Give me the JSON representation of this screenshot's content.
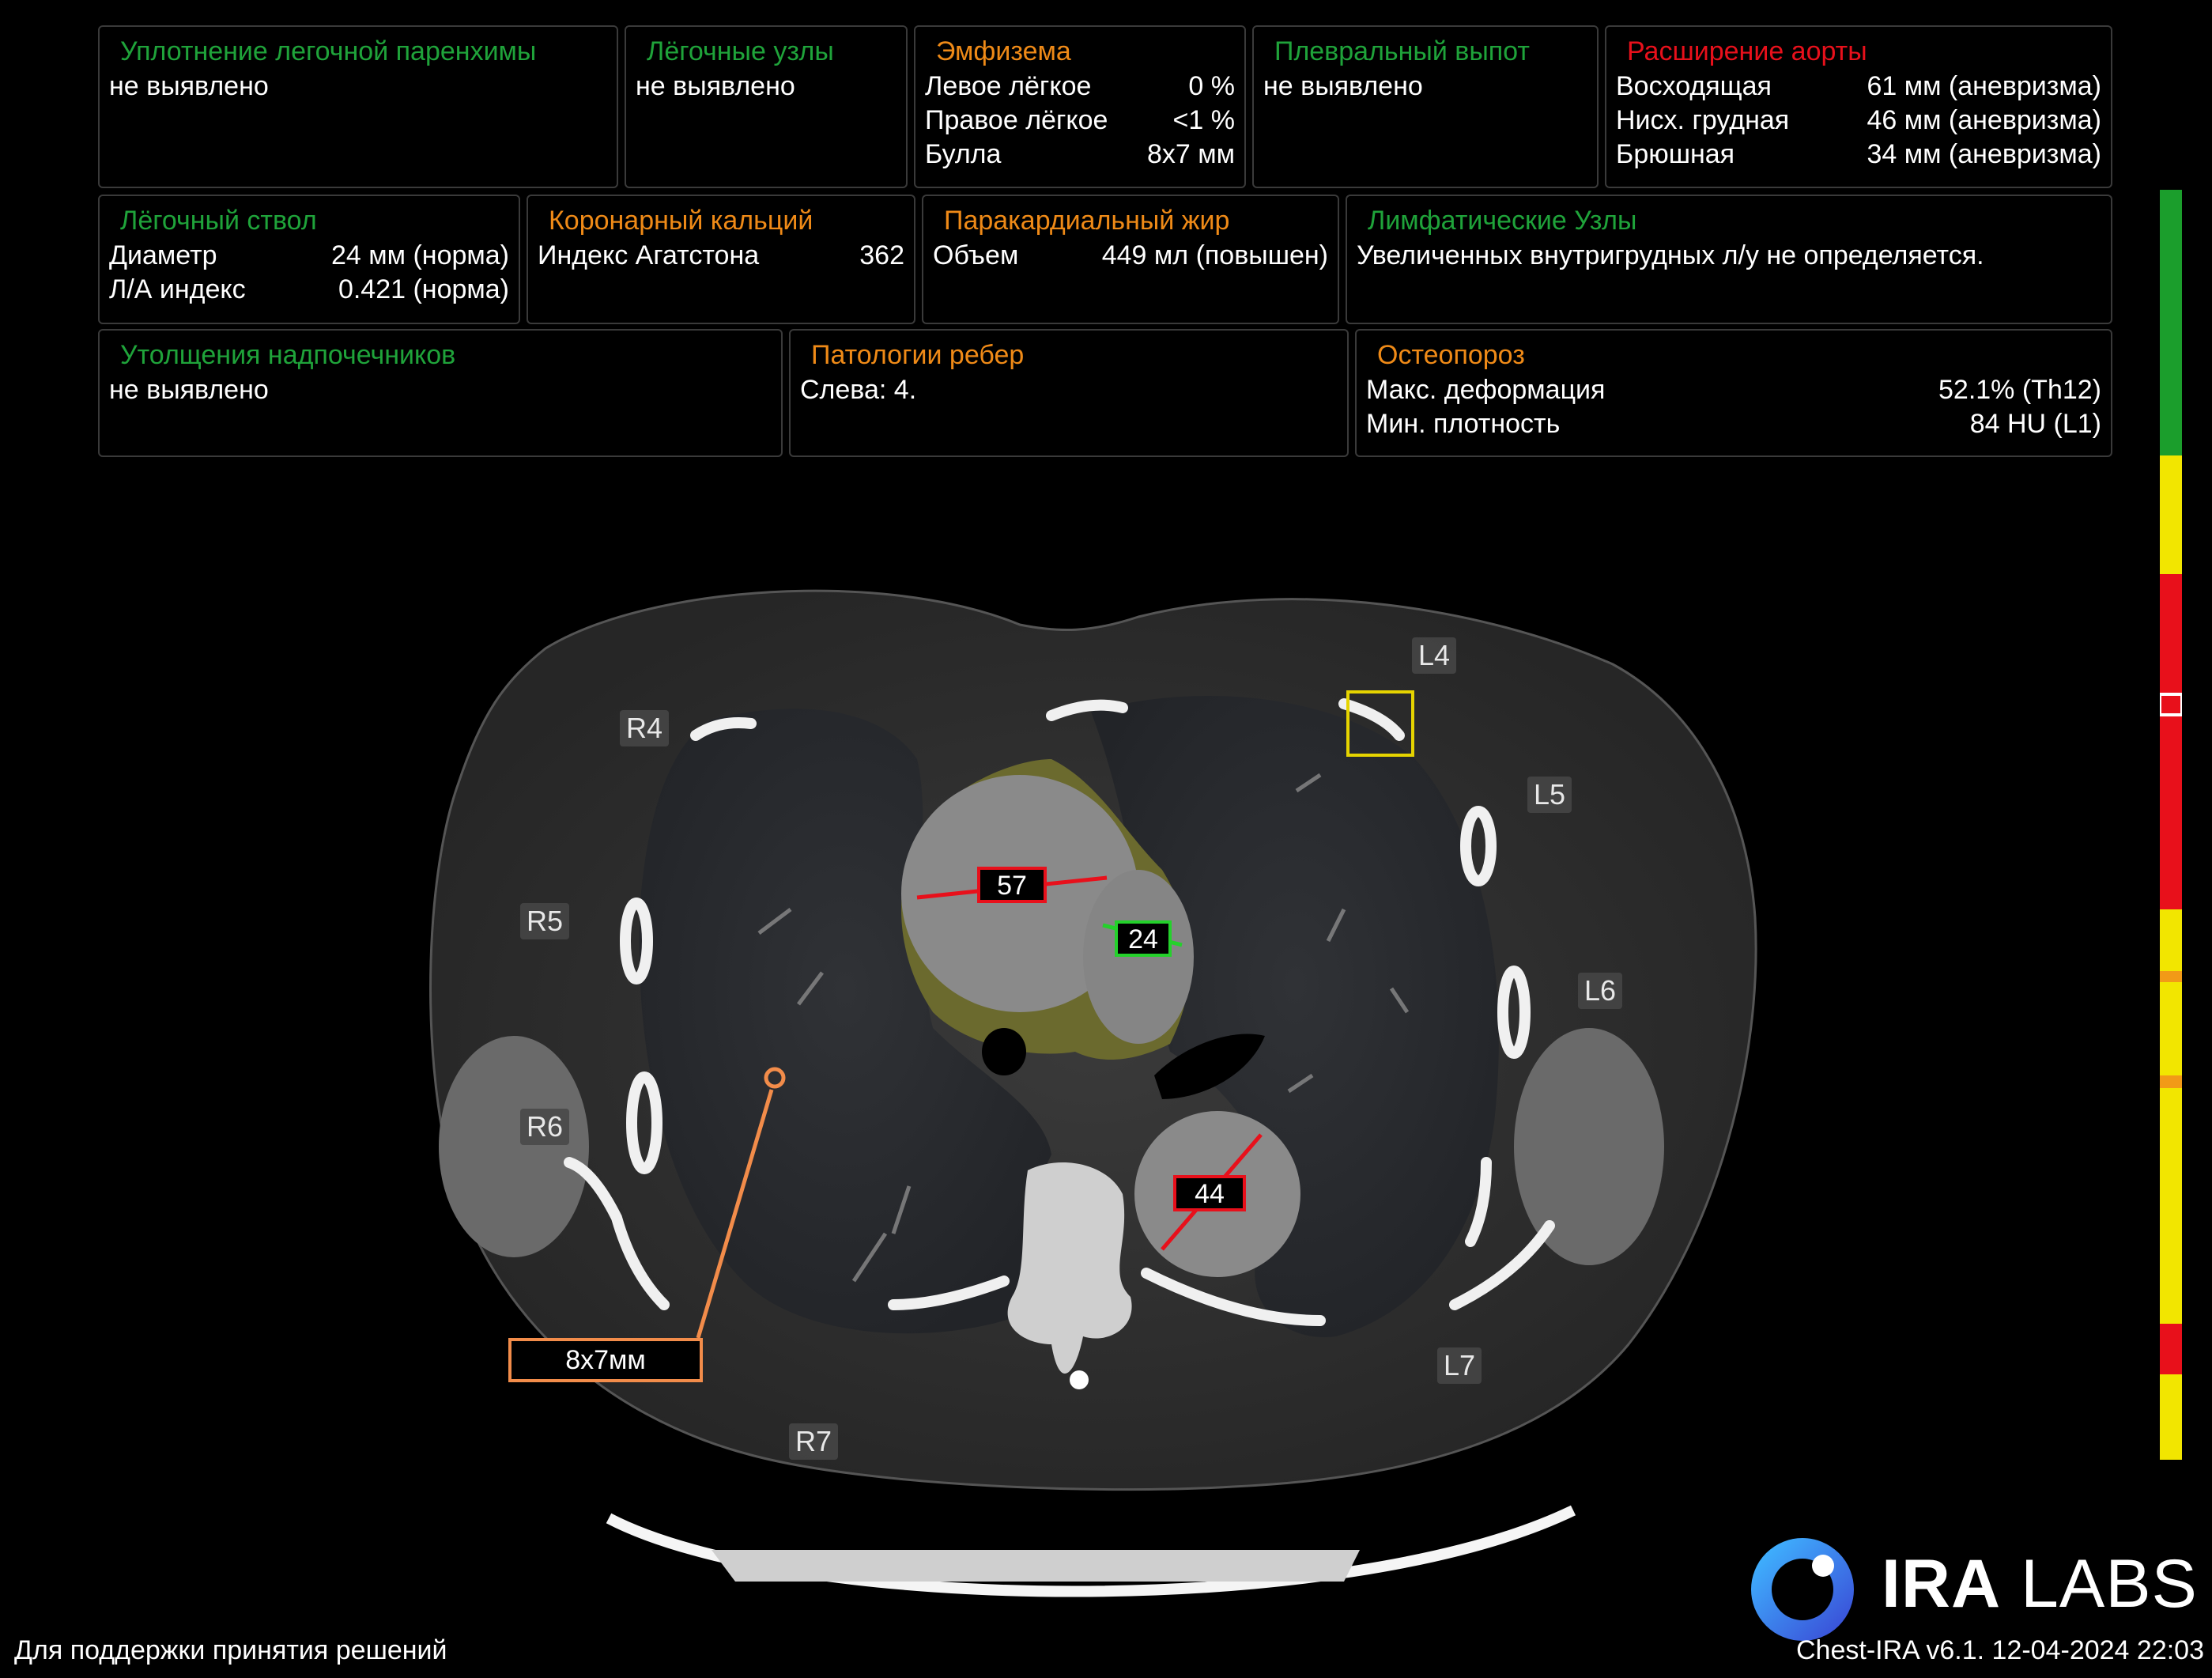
{
  "colors": {
    "normal": "#1fa33a",
    "warning": "#ef8a17",
    "alert": "#e8101b",
    "measure_orange": "#f28c4a",
    "highlight": "#e6d400"
  },
  "panels": {
    "parenchyma": {
      "title": "Уплотнение легочной паренхимы",
      "status": "не выявлено"
    },
    "nodules": {
      "title": "Лёгочные узлы",
      "status": "не выявлено"
    },
    "emphysema": {
      "title": "Эмфизема",
      "rows": [
        {
          "label": "Левое лёгкое",
          "value": "0 %"
        },
        {
          "label": "Правое лёгкое",
          "value": "<1 %"
        },
        {
          "label": "Булла",
          "value": "8x7 мм"
        }
      ]
    },
    "pleural": {
      "title": "Плевральный выпот",
      "status": "не выявлено"
    },
    "aorta": {
      "title": "Расширение аорты",
      "rows": [
        {
          "label": "Восходящая",
          "value": "61 мм (аневризма)"
        },
        {
          "label": "Нисх. грудная",
          "value": "46 мм (аневризма)"
        },
        {
          "label": "Брюшная",
          "value": "34 мм (аневризма)"
        }
      ]
    },
    "pulmonary_trunk": {
      "title": "Лёгочный ствол",
      "rows": [
        {
          "label": "Диаметр",
          "value": "24 мм (норма)"
        },
        {
          "label": "Л/А индекс",
          "value": "0.421 (норма)"
        }
      ]
    },
    "coronary": {
      "title": "Коронарный кальций",
      "rows": [
        {
          "label": "Индекс Агатстона",
          "value": "362"
        }
      ]
    },
    "pericardial_fat": {
      "title": "Паракардиальный жир",
      "rows": [
        {
          "label": "Объем",
          "value": "449 мл (повышен)"
        }
      ]
    },
    "lymph": {
      "title": "Лимфатические Узлы",
      "status": "Увеличенных внутригрудных л/у не определяется."
    },
    "adrenal": {
      "title": "Утолщения надпочечников",
      "status": "не выявлено"
    },
    "ribs": {
      "title": "Патологии ребер",
      "status": "Слева: 4."
    },
    "osteoporosis": {
      "title": "Остеопороз",
      "rows": [
        {
          "label": "Макс. деформация",
          "value": "52.1% (Th12)"
        },
        {
          "label": "Мин. плотность",
          "value": "84 HU (L1)"
        }
      ]
    }
  },
  "scan": {
    "rib_labels": [
      "R4",
      "R5",
      "R6",
      "R7",
      "L4",
      "L5",
      "L6",
      "L7"
    ],
    "measurements": {
      "aorta_ascending": "57",
      "pulmonary_trunk": "24",
      "aorta_descending": "44",
      "bulla": "8x7мм"
    }
  },
  "footer": {
    "disclaimer": "Для поддержки принятия решений",
    "version": "Chest-IRA v6.1. 12-04-2024 22:03",
    "logo_bold": "IRA",
    "logo_light": " LABS"
  }
}
